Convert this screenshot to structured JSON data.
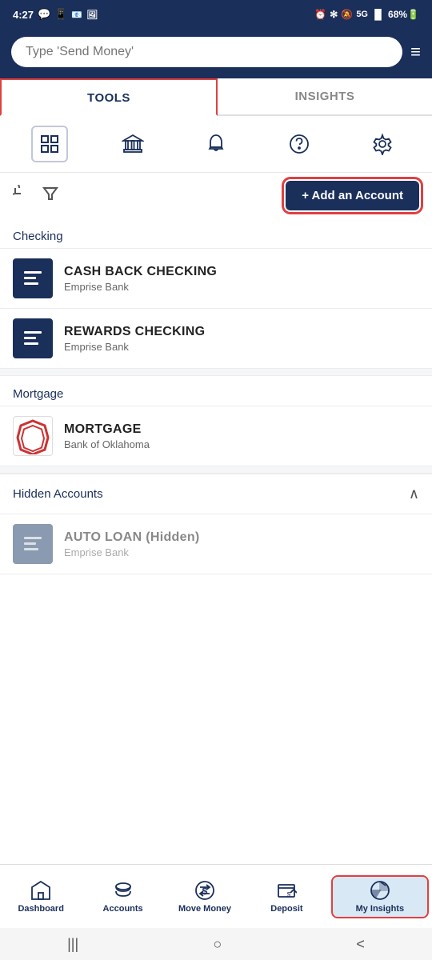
{
  "statusBar": {
    "time": "4:27",
    "rightIcons": [
      "alarm",
      "bluetooth",
      "mute",
      "5g",
      "signal",
      "battery"
    ],
    "battery": "68%"
  },
  "header": {
    "searchPlaceholder": "Type 'Send Money'",
    "menuIcon": "≡"
  },
  "tabs": [
    {
      "id": "tools",
      "label": "TOOLS",
      "active": true
    },
    {
      "id": "insights",
      "label": "INSIGHTS",
      "active": false
    }
  ],
  "iconToolbar": [
    {
      "id": "grid",
      "name": "grid-icon",
      "active": true
    },
    {
      "id": "bank",
      "name": "bank-icon",
      "active": false
    },
    {
      "id": "bell",
      "name": "bell-icon",
      "active": false
    },
    {
      "id": "help",
      "name": "help-icon",
      "active": false
    },
    {
      "id": "settings",
      "name": "settings-icon",
      "active": false
    }
  ],
  "actionBar": {
    "refreshLabel": "↻",
    "filterLabel": "⛉",
    "addAccountLabel": "+ Add an Account"
  },
  "sections": [
    {
      "id": "checking",
      "label": "Checking",
      "accounts": [
        {
          "id": "cash-back-checking",
          "name": "CASH BACK CHECKING",
          "bank": "Emprise Bank",
          "logoType": "emprise",
          "hidden": false
        },
        {
          "id": "rewards-checking",
          "name": "REWARDS CHECKING",
          "bank": "Emprise Bank",
          "logoType": "emprise",
          "hidden": false
        }
      ]
    },
    {
      "id": "mortgage",
      "label": "Mortgage",
      "accounts": [
        {
          "id": "mortgage",
          "name": "MORTGAGE",
          "bank": "Bank of Oklahoma",
          "logoType": "mortgage",
          "hidden": false
        }
      ]
    }
  ],
  "hiddenAccounts": {
    "label": "Hidden Accounts",
    "expanded": true,
    "accounts": [
      {
        "id": "auto-loan",
        "name": "AUTO LOAN (Hidden)",
        "bank": "Emprise Bank",
        "logoType": "hidden",
        "hidden": true
      }
    ]
  },
  "bottomNav": [
    {
      "id": "dashboard",
      "label": "Dashboard",
      "icon": "🏛",
      "active": false
    },
    {
      "id": "accounts",
      "label": "Accounts",
      "icon": "💰",
      "active": false
    },
    {
      "id": "move-money",
      "label": "Move Money",
      "icon": "💲",
      "active": false
    },
    {
      "id": "deposit",
      "label": "Deposit",
      "icon": "📋",
      "active": false
    },
    {
      "id": "my-insights",
      "label": "My Insights",
      "icon": "📊",
      "active": true
    }
  ],
  "systemNav": {
    "buttons": [
      "|||",
      "○",
      "<"
    ]
  }
}
